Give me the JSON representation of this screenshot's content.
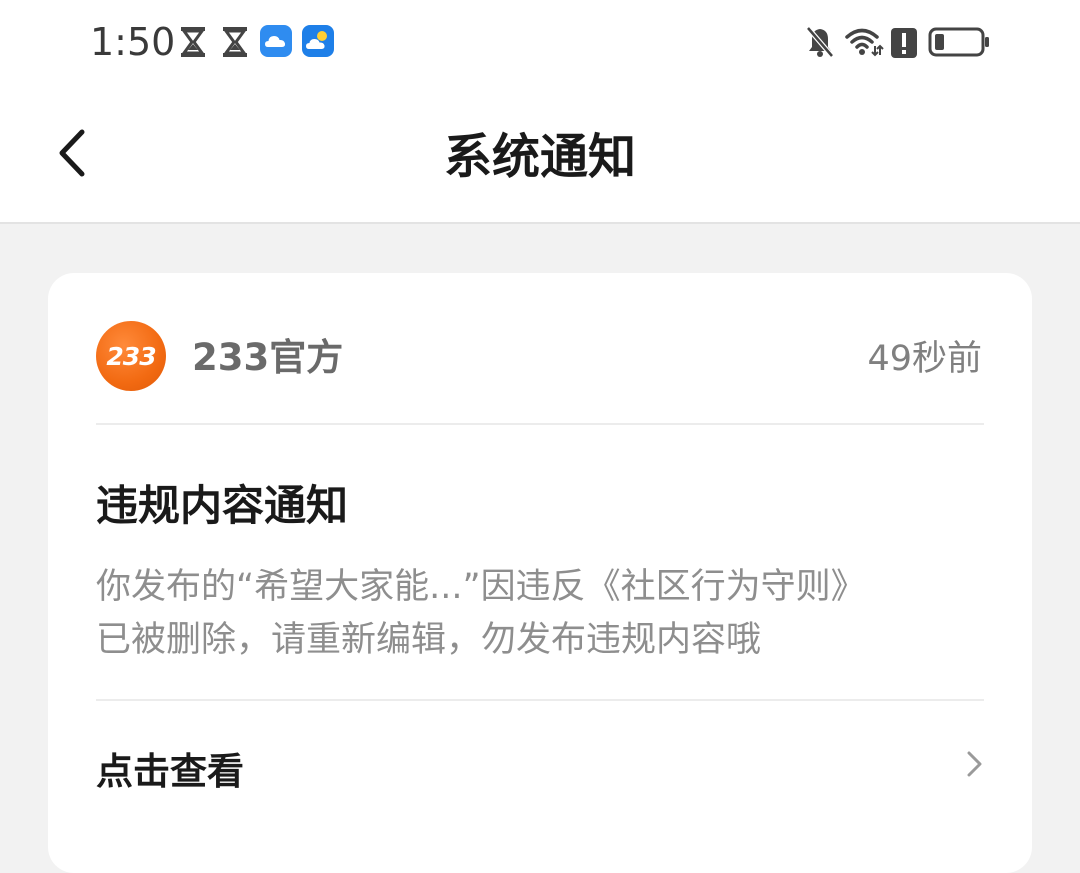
{
  "status_bar": {
    "time": "1:50",
    "icons": [
      "hourglass-icon",
      "hourglass-icon",
      "cloud-app-icon",
      "weather-app-icon",
      "bell-muted-icon",
      "wifi-icon",
      "alert-icon",
      "battery-icon"
    ],
    "battery_level": 0.2
  },
  "header": {
    "back_icon": "chevron-left-icon",
    "title": "系统通知"
  },
  "notification": {
    "avatar_text": "233",
    "sender": "233官方",
    "time_ago": "49秒前",
    "title": "违规内容通知",
    "body_lines": [
      "你发布的“希望大家能...”因违反《社区行为守则》",
      "已被删除，请重新编辑，勿发布违规内容哦"
    ],
    "action_label": "点击查看",
    "action_icon": "chevron-right-icon"
  },
  "colors": {
    "accent_orange": "#f26a12",
    "page_bg": "#f2f2f2",
    "card_bg": "#ffffff",
    "body_text": "#8e8e8e"
  }
}
